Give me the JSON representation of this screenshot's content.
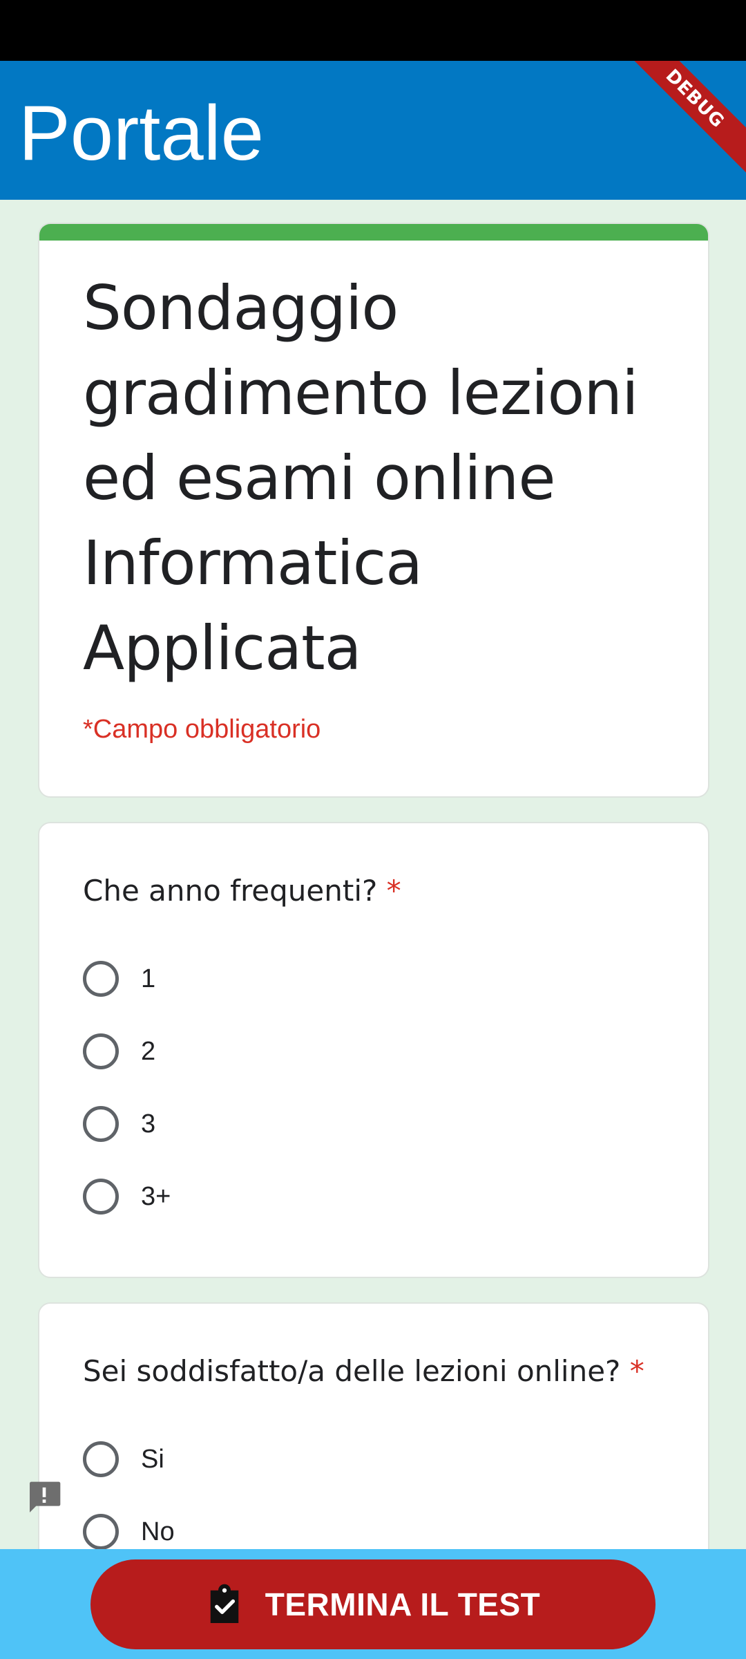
{
  "app_bar": {
    "title": "Portale",
    "debug_banner": "DEBUG",
    "background_color": "#0278c3"
  },
  "form": {
    "title": "Sondaggio gradimento lezioni ed esami online Informatica Applicata",
    "required_note": "*Campo obbligatorio",
    "accent_color": "#4caf50"
  },
  "questions": [
    {
      "text": "Che anno frequenti?",
      "required_mark": "*",
      "options": [
        "1",
        "2",
        "3",
        "3+"
      ]
    },
    {
      "text": "Sei soddisfatto/a delle lezioni online?",
      "required_mark": "*",
      "options": [
        "Si",
        "No"
      ]
    }
  ],
  "feedback": {
    "icon": "feedback-icon"
  },
  "bottom_bar": {
    "button_label": "TERMINA IL TEST",
    "button_icon": "clipboard-check-icon",
    "button_color": "#b71c1c",
    "bar_color": "#4fc3f7"
  }
}
